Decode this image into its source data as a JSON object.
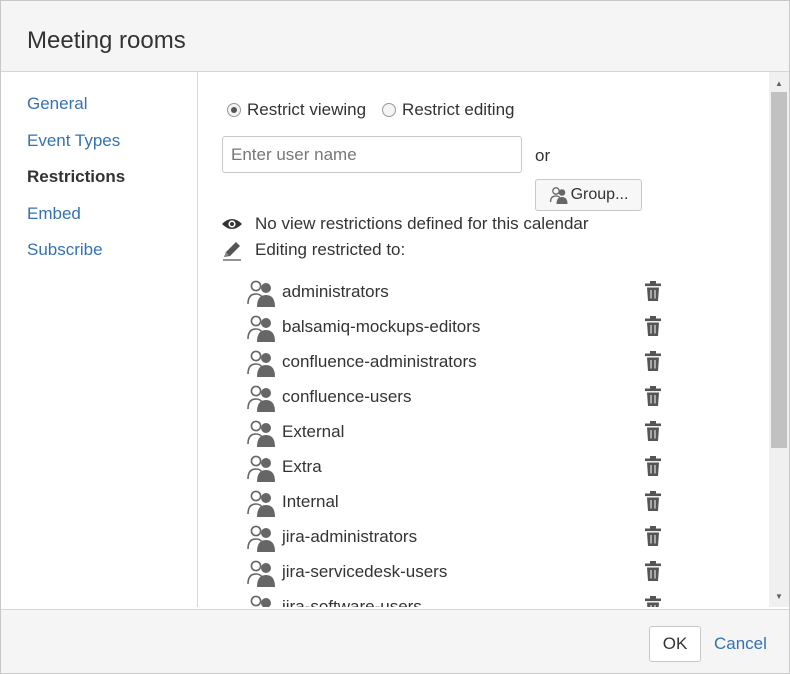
{
  "dialog": {
    "title": "Meeting rooms"
  },
  "nav": {
    "items": [
      {
        "label": "General",
        "active": false
      },
      {
        "label": "Event Types",
        "active": false
      },
      {
        "label": "Restrictions",
        "active": true
      },
      {
        "label": "Embed",
        "active": false
      },
      {
        "label": "Subscribe",
        "active": false
      }
    ]
  },
  "restrictions": {
    "mode_options": [
      {
        "label": "Restrict viewing",
        "checked": true
      },
      {
        "label": "Restrict editing",
        "checked": false
      }
    ],
    "user_input": {
      "placeholder": "Enter user name",
      "value": ""
    },
    "or_label": "or",
    "group_button_label": "Group...",
    "view_status": "No view restrictions defined for this calendar",
    "edit_status": "Editing restricted to:",
    "groups": [
      "administrators",
      "balsamiq-mockups-editors",
      "confluence-administrators",
      "confluence-users",
      "External",
      "Extra",
      "Internal",
      "jira-administrators",
      "jira-servicedesk-users",
      "jira-software-users"
    ]
  },
  "footer": {
    "ok_label": "OK",
    "cancel_label": "Cancel"
  },
  "colors": {
    "link": "#3572b0",
    "icon": "#555555",
    "header_bg": "#f5f5f5"
  },
  "icons": {
    "view": "eye-icon",
    "edit": "pencil-icon",
    "group": "group-icon",
    "remove": "trash-icon"
  }
}
